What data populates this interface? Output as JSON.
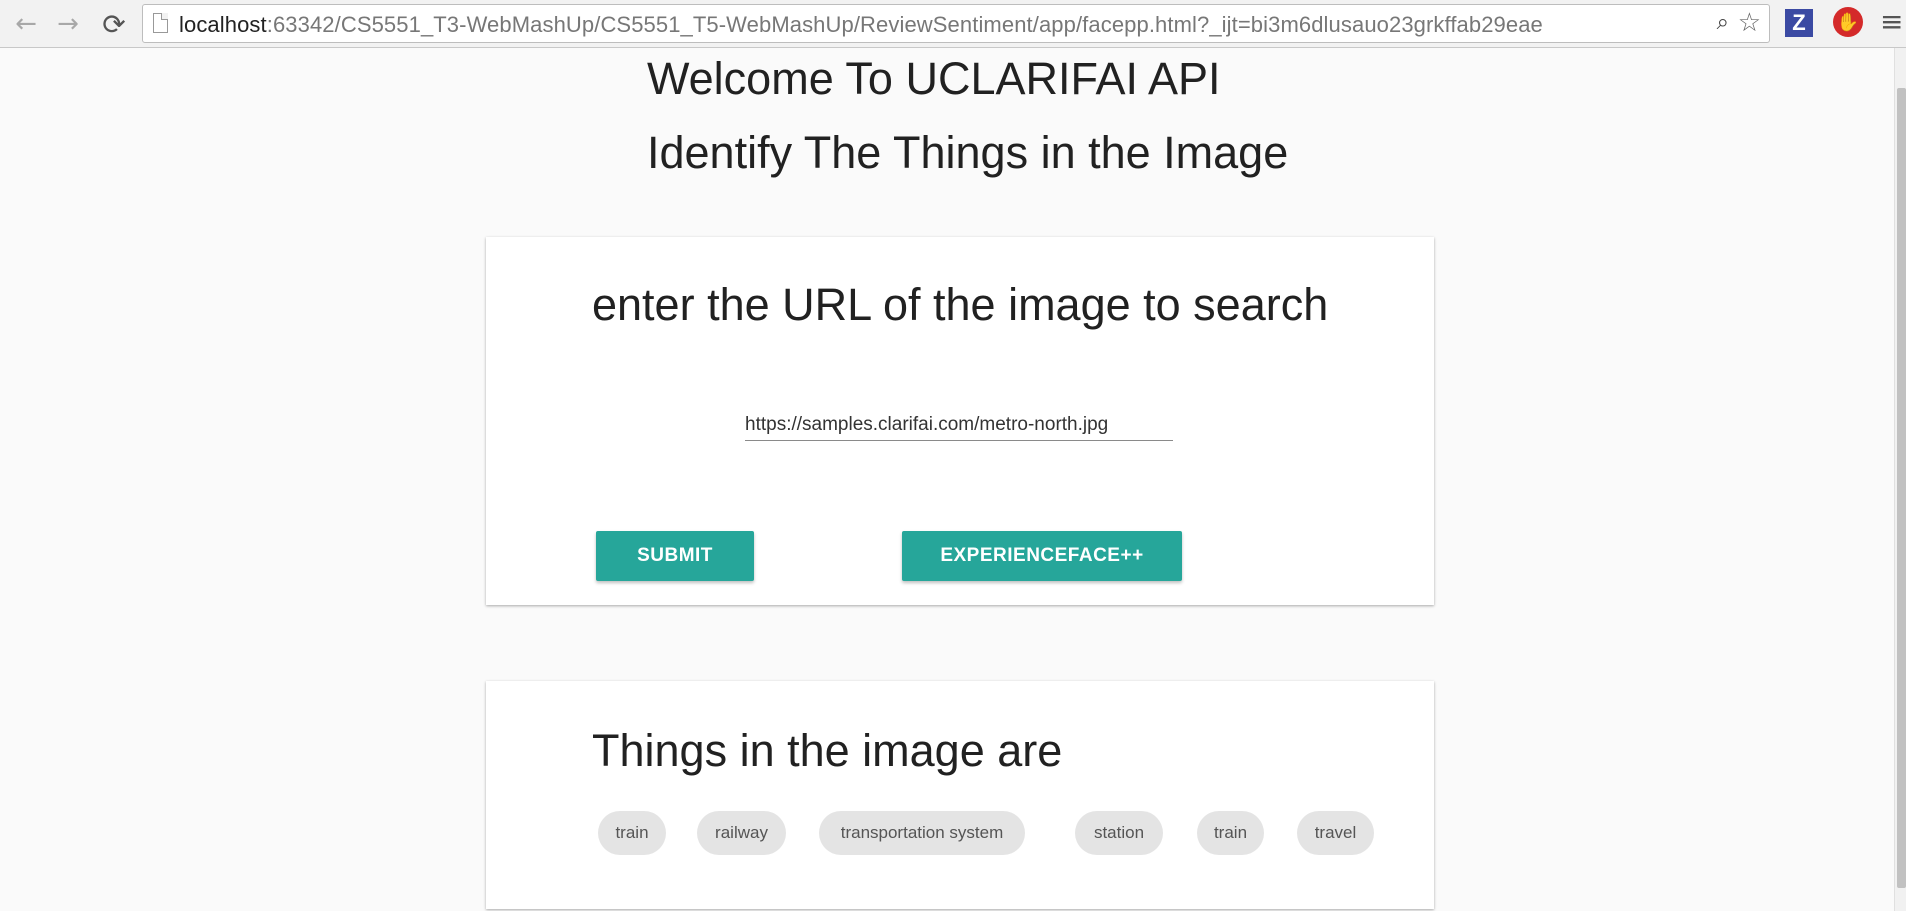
{
  "browser": {
    "back_icon": "←",
    "forward_icon": "→",
    "reload_icon": "⟳",
    "url_host": "localhost",
    "url_rest": ":63342/CS5551_T3-WebMashUp/CS5551_T5-WebMashUp/ReviewSentiment/app/facepp.html?_ijt=bi3m6dlusauo23grkffab29eae",
    "zoom_icon": "⌕",
    "star_icon": "☆",
    "ext_z_label": "Z",
    "ext_stop_icon": "✋",
    "menu_icon": "≡"
  },
  "page": {
    "heading1": "Welcome To UCLARIFAI API",
    "heading2": "Identify The Things in the Image"
  },
  "search_card": {
    "title": "enter the URL of the image to search",
    "url_value": "https://samples.clarifai.com/metro-north.jpg",
    "submit_label": "SUBMIT",
    "face_label": "EXPERIENCEFACE++"
  },
  "results_card": {
    "title": "Things in the image are",
    "tags": [
      "train",
      "railway",
      "transportation system",
      "station",
      "train",
      "travel"
    ]
  },
  "colors": {
    "accent": "#26a69a",
    "chip_bg": "#e4e4e4",
    "page_bg": "#fafafa"
  }
}
